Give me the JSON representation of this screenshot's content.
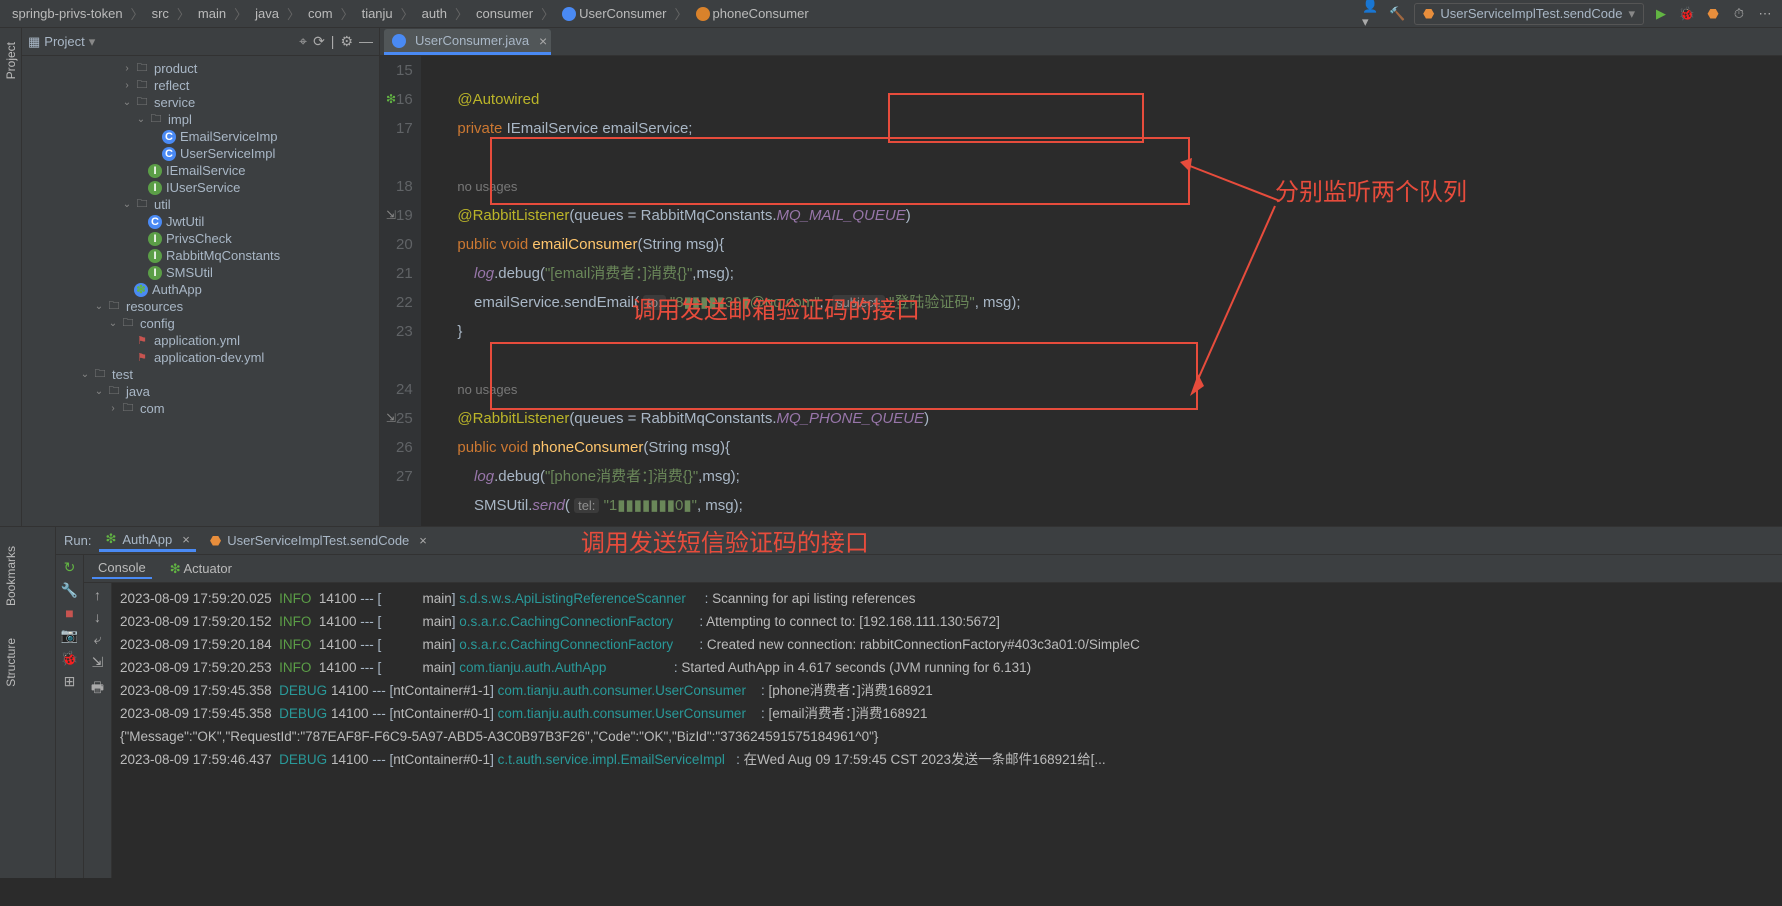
{
  "breadcrumb": {
    "root": "springb-privs-token",
    "parts": [
      "src",
      "main",
      "java",
      "com",
      "tianju",
      "auth",
      "consumer"
    ],
    "cls": "UserConsumer",
    "method": "phoneConsumer"
  },
  "runConfig": "UserServiceImplTest.sendCode",
  "project": {
    "title": "Project",
    "tree": [
      {
        "d": 7,
        "a": ">",
        "i": "dir",
        "t": "product"
      },
      {
        "d": 7,
        "a": ">",
        "i": "dir",
        "t": "reflect"
      },
      {
        "d": 7,
        "a": "v",
        "i": "dir",
        "t": "service"
      },
      {
        "d": 8,
        "a": "v",
        "i": "dir",
        "t": "impl"
      },
      {
        "d": 9,
        "a": "",
        "i": "cls",
        "t": "EmailServiceImp"
      },
      {
        "d": 9,
        "a": "",
        "i": "cls",
        "t": "UserServiceImpl"
      },
      {
        "d": 8,
        "a": "",
        "i": "intf",
        "t": "IEmailService"
      },
      {
        "d": 8,
        "a": "",
        "i": "intf",
        "t": "IUserService"
      },
      {
        "d": 7,
        "a": "v",
        "i": "dir",
        "t": "util"
      },
      {
        "d": 8,
        "a": "",
        "i": "cls",
        "t": "JwtUtil"
      },
      {
        "d": 8,
        "a": "",
        "i": "intf",
        "t": "PrivsCheck"
      },
      {
        "d": 8,
        "a": "",
        "i": "intf",
        "t": "RabbitMqConstants"
      },
      {
        "d": 8,
        "a": "",
        "i": "intf",
        "t": "SMSUtil"
      },
      {
        "d": 7,
        "a": "",
        "i": "cls",
        "t": "AuthApp",
        "leaf": true
      },
      {
        "d": 5,
        "a": "v",
        "i": "dir",
        "t": "resources"
      },
      {
        "d": 6,
        "a": "v",
        "i": "dir",
        "t": "config"
      },
      {
        "d": 7,
        "a": "",
        "i": "yml",
        "t": "application.yml"
      },
      {
        "d": 7,
        "a": "",
        "i": "yml",
        "t": "application-dev.yml"
      },
      {
        "d": 4,
        "a": "v",
        "i": "dir",
        "t": "test"
      },
      {
        "d": 5,
        "a": "v",
        "i": "dir",
        "t": "java"
      },
      {
        "d": 6,
        "a": ">",
        "i": "dir",
        "t": "com"
      }
    ]
  },
  "tabs": {
    "active": "UserConsumer.java"
  },
  "code": {
    "lines": [
      15,
      16,
      17,
      "",
      18,
      19,
      20,
      21,
      22,
      23,
      "",
      24,
      25,
      26,
      27
    ]
  },
  "annotations": {
    "a1": "分别监听两个队列",
    "a2": "调用发送邮箱验证码的接口",
    "a3": "调用发送短信验证码的接口"
  },
  "run": {
    "label": "Run:",
    "tab1": "AuthApp",
    "tab2": "UserServiceImplTest.sendCode",
    "sub1": "Console",
    "sub2": "Actuator"
  },
  "console": [
    {
      "ts": "2023-08-09 17:59:20.025",
      "lvl": "INFO",
      "pid": "14100",
      "thr": "main",
      "lg": "s.d.s.w.s.ApiListingReferenceScanner",
      "m": "Scanning for api listing references"
    },
    {
      "ts": "2023-08-09 17:59:20.152",
      "lvl": "INFO",
      "pid": "14100",
      "thr": "main",
      "lg": "o.s.a.r.c.CachingConnectionFactory",
      "m": "Attempting to connect to: [192.168.111.130:5672]"
    },
    {
      "ts": "2023-08-09 17:59:20.184",
      "lvl": "INFO",
      "pid": "14100",
      "thr": "main",
      "lg": "o.s.a.r.c.CachingConnectionFactory",
      "m": "Created new connection: rabbitConnectionFactory#403c3a01:0/SimpleC"
    },
    {
      "ts": "2023-08-09 17:59:20.253",
      "lvl": "INFO",
      "pid": "14100",
      "thr": "main",
      "lg": "com.tianju.auth.AuthApp",
      "m": "Started AuthApp in 4.617 seconds (JVM running for 6.131)"
    },
    {
      "ts": "2023-08-09 17:59:45.358",
      "lvl": "DEBUG",
      "pid": "14100",
      "thr": "ntContainer#1-1",
      "lg": "com.tianju.auth.consumer.UserConsumer",
      "m": "[phone消费者：]消费168921"
    },
    {
      "ts": "2023-08-09 17:59:45.358",
      "lvl": "DEBUG",
      "pid": "14100",
      "thr": "ntContainer#0-1",
      "lg": "com.tianju.auth.consumer.UserConsumer",
      "m": "[email消费者：]消费168921"
    },
    {
      "raw": "{\"Message\":\"OK\",\"RequestId\":\"787EAF8F-F6C9-5A97-ABD5-A3C0B97B3F26\",\"Code\":\"OK\",\"BizId\":\"373624591575184961^0\"}"
    },
    {
      "ts": "2023-08-09 17:59:46.437",
      "lvl": "DEBUG",
      "pid": "14100",
      "thr": "ntContainer#0-1",
      "lg": "c.t.auth.service.impl.EmailServiceImpl",
      "m": "在Wed Aug 09 17:59:45 CST 2023发送一条邮件168921给[..."
    }
  ],
  "sideTabs": {
    "project": "Project",
    "bookmarks": "Bookmarks",
    "structure": "Structure"
  }
}
